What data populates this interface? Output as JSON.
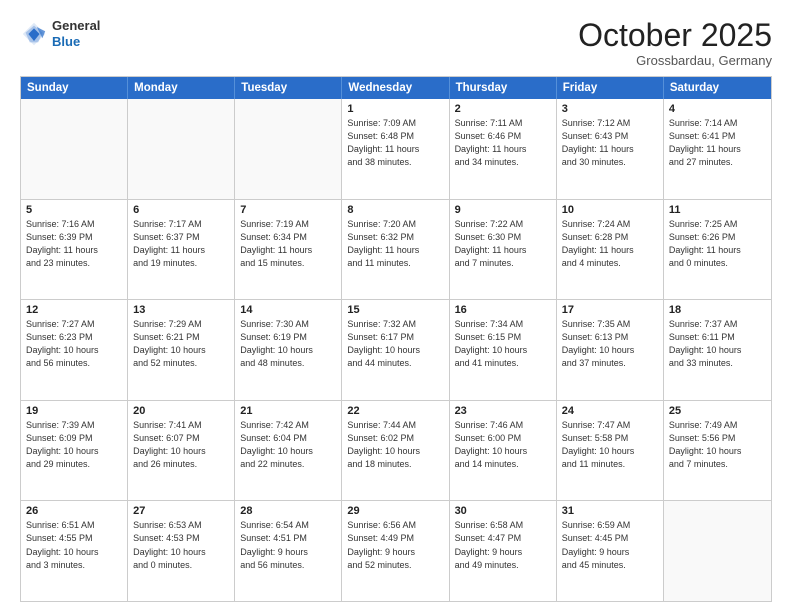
{
  "header": {
    "logo_general": "General",
    "logo_blue": "Blue",
    "month_title": "October 2025",
    "location": "Grossbardau, Germany"
  },
  "weekdays": [
    "Sunday",
    "Monday",
    "Tuesday",
    "Wednesday",
    "Thursday",
    "Friday",
    "Saturday"
  ],
  "rows": [
    [
      {
        "day": "",
        "info": "",
        "empty": true
      },
      {
        "day": "",
        "info": "",
        "empty": true
      },
      {
        "day": "",
        "info": "",
        "empty": true
      },
      {
        "day": "1",
        "info": "Sunrise: 7:09 AM\nSunset: 6:48 PM\nDaylight: 11 hours\nand 38 minutes."
      },
      {
        "day": "2",
        "info": "Sunrise: 7:11 AM\nSunset: 6:46 PM\nDaylight: 11 hours\nand 34 minutes."
      },
      {
        "day": "3",
        "info": "Sunrise: 7:12 AM\nSunset: 6:43 PM\nDaylight: 11 hours\nand 30 minutes."
      },
      {
        "day": "4",
        "info": "Sunrise: 7:14 AM\nSunset: 6:41 PM\nDaylight: 11 hours\nand 27 minutes."
      }
    ],
    [
      {
        "day": "5",
        "info": "Sunrise: 7:16 AM\nSunset: 6:39 PM\nDaylight: 11 hours\nand 23 minutes."
      },
      {
        "day": "6",
        "info": "Sunrise: 7:17 AM\nSunset: 6:37 PM\nDaylight: 11 hours\nand 19 minutes."
      },
      {
        "day": "7",
        "info": "Sunrise: 7:19 AM\nSunset: 6:34 PM\nDaylight: 11 hours\nand 15 minutes."
      },
      {
        "day": "8",
        "info": "Sunrise: 7:20 AM\nSunset: 6:32 PM\nDaylight: 11 hours\nand 11 minutes."
      },
      {
        "day": "9",
        "info": "Sunrise: 7:22 AM\nSunset: 6:30 PM\nDaylight: 11 hours\nand 7 minutes."
      },
      {
        "day": "10",
        "info": "Sunrise: 7:24 AM\nSunset: 6:28 PM\nDaylight: 11 hours\nand 4 minutes."
      },
      {
        "day": "11",
        "info": "Sunrise: 7:25 AM\nSunset: 6:26 PM\nDaylight: 11 hours\nand 0 minutes."
      }
    ],
    [
      {
        "day": "12",
        "info": "Sunrise: 7:27 AM\nSunset: 6:23 PM\nDaylight: 10 hours\nand 56 minutes."
      },
      {
        "day": "13",
        "info": "Sunrise: 7:29 AM\nSunset: 6:21 PM\nDaylight: 10 hours\nand 52 minutes."
      },
      {
        "day": "14",
        "info": "Sunrise: 7:30 AM\nSunset: 6:19 PM\nDaylight: 10 hours\nand 48 minutes."
      },
      {
        "day": "15",
        "info": "Sunrise: 7:32 AM\nSunset: 6:17 PM\nDaylight: 10 hours\nand 44 minutes."
      },
      {
        "day": "16",
        "info": "Sunrise: 7:34 AM\nSunset: 6:15 PM\nDaylight: 10 hours\nand 41 minutes."
      },
      {
        "day": "17",
        "info": "Sunrise: 7:35 AM\nSunset: 6:13 PM\nDaylight: 10 hours\nand 37 minutes."
      },
      {
        "day": "18",
        "info": "Sunrise: 7:37 AM\nSunset: 6:11 PM\nDaylight: 10 hours\nand 33 minutes."
      }
    ],
    [
      {
        "day": "19",
        "info": "Sunrise: 7:39 AM\nSunset: 6:09 PM\nDaylight: 10 hours\nand 29 minutes."
      },
      {
        "day": "20",
        "info": "Sunrise: 7:41 AM\nSunset: 6:07 PM\nDaylight: 10 hours\nand 26 minutes."
      },
      {
        "day": "21",
        "info": "Sunrise: 7:42 AM\nSunset: 6:04 PM\nDaylight: 10 hours\nand 22 minutes."
      },
      {
        "day": "22",
        "info": "Sunrise: 7:44 AM\nSunset: 6:02 PM\nDaylight: 10 hours\nand 18 minutes."
      },
      {
        "day": "23",
        "info": "Sunrise: 7:46 AM\nSunset: 6:00 PM\nDaylight: 10 hours\nand 14 minutes."
      },
      {
        "day": "24",
        "info": "Sunrise: 7:47 AM\nSunset: 5:58 PM\nDaylight: 10 hours\nand 11 minutes."
      },
      {
        "day": "25",
        "info": "Sunrise: 7:49 AM\nSunset: 5:56 PM\nDaylight: 10 hours\nand 7 minutes."
      }
    ],
    [
      {
        "day": "26",
        "info": "Sunrise: 6:51 AM\nSunset: 4:55 PM\nDaylight: 10 hours\nand 3 minutes."
      },
      {
        "day": "27",
        "info": "Sunrise: 6:53 AM\nSunset: 4:53 PM\nDaylight: 10 hours\nand 0 minutes."
      },
      {
        "day": "28",
        "info": "Sunrise: 6:54 AM\nSunset: 4:51 PM\nDaylight: 9 hours\nand 56 minutes."
      },
      {
        "day": "29",
        "info": "Sunrise: 6:56 AM\nSunset: 4:49 PM\nDaylight: 9 hours\nand 52 minutes."
      },
      {
        "day": "30",
        "info": "Sunrise: 6:58 AM\nSunset: 4:47 PM\nDaylight: 9 hours\nand 49 minutes."
      },
      {
        "day": "31",
        "info": "Sunrise: 6:59 AM\nSunset: 4:45 PM\nDaylight: 9 hours\nand 45 minutes."
      },
      {
        "day": "",
        "info": "",
        "empty": true
      }
    ]
  ]
}
